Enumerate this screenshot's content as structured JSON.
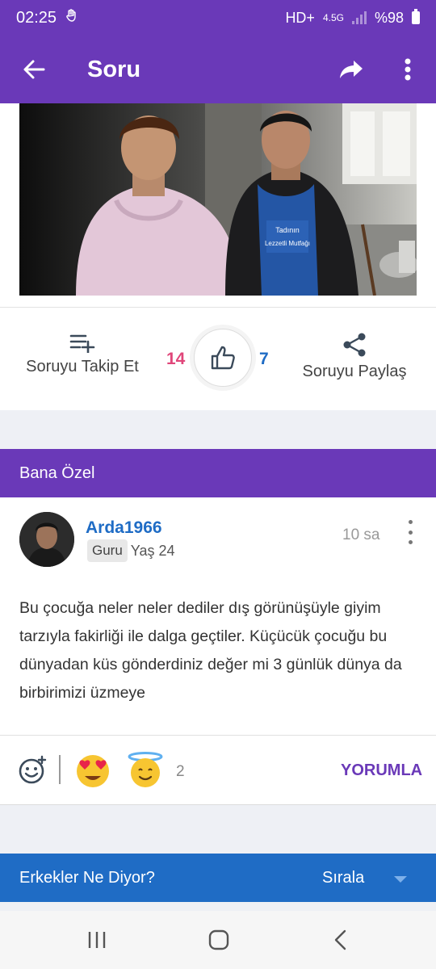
{
  "status_bar": {
    "time": "02:25",
    "network_label": "HD+",
    "network_type": "4.5G",
    "battery": "%98"
  },
  "app_bar": {
    "title": "Soru",
    "icons": [
      "arrow-left-icon",
      "share-forward-icon",
      "more-vertical-icon"
    ]
  },
  "question": {
    "follow_label": "Soruyu Takip Et",
    "share_label": "Soruyu Paylaş",
    "like_count": "14",
    "dislike_count": "7"
  },
  "section": {
    "title": "Bana Özel"
  },
  "comment": {
    "username": "Arda1966",
    "badge": "Guru",
    "age": "Yaş 24",
    "time": "10 sa",
    "text": "Bu çocuğa neler neler dediler dış görünüşüyle giyim tarzıyla fakirliği ile dalga geçtiler. Küçücük çocuğu bu dünyadan küs gönderdiniz değer mi 3 günlük dünya da birbirimizi üzmeye",
    "reaction_count": "2",
    "comment_button": "YORUMLA"
  },
  "men_section": {
    "title": "Erkekler Ne Diyor?",
    "sort_label": "Sırala"
  },
  "apron_text": {
    "line1": "Tadının",
    "line2": "Lezzetli Mutfağı"
  },
  "colors": {
    "primary_purple": "#6a39b8",
    "blue": "#1f6cc5",
    "like_pink": "#e0467a",
    "dislike_blue": "#1f6cc5"
  }
}
